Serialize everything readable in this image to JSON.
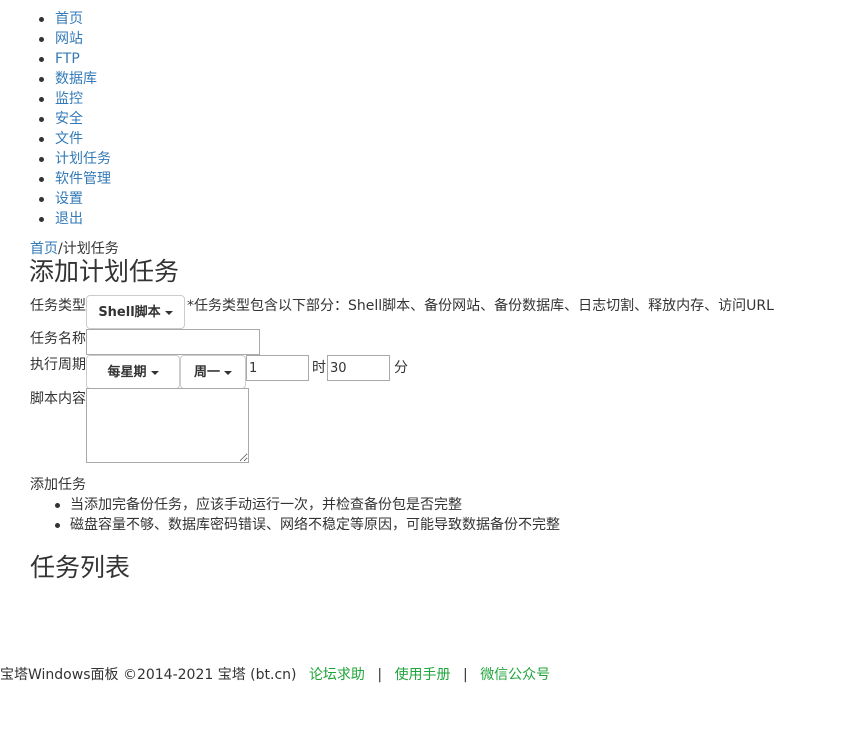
{
  "nav": {
    "items": [
      {
        "label": "首页"
      },
      {
        "label": "网站"
      },
      {
        "label": "FTP"
      },
      {
        "label": "数据库"
      },
      {
        "label": "监控"
      },
      {
        "label": "安全"
      },
      {
        "label": "文件"
      },
      {
        "label": "计划任务"
      },
      {
        "label": "软件管理"
      },
      {
        "label": "设置"
      },
      {
        "label": "退出"
      }
    ]
  },
  "breadcrumb": {
    "home": "首页",
    "separator": "/",
    "current": "计划任务"
  },
  "page_title": "添加计划任务",
  "form": {
    "task_type": {
      "label": "任务类型",
      "selected": "Shell脚本",
      "hint": "*任务类型包含以下部分：Shell脚本、备份网站、备份数据库、日志切割、释放内存、访问URL"
    },
    "task_name": {
      "label": "任务名称",
      "value": ""
    },
    "period": {
      "label": "执行周期",
      "cycle_selected": "每星期",
      "weekday_selected": "周一",
      "hour_value": "1",
      "hour_unit": "时",
      "minute_value": "30",
      "minute_unit": "分"
    },
    "script": {
      "label": "脚本内容",
      "value": ""
    },
    "submit_label": "添加任务"
  },
  "notes": [
    "当添加完备份任务，应该手动运行一次，并检查备份包是否完整",
    "磁盘容量不够、数据库密码错误、网络不稳定等原因，可能导致数据备份不完整"
  ],
  "task_list_title": "任务列表",
  "footer": {
    "copyright": "宝塔Windows面板 ©2014-2021 宝塔 (bt.cn)",
    "link_forum": "论坛求助",
    "link_manual": "使用手册",
    "link_wechat": "微信公众号",
    "separator": "|",
    "link_color": "#20a53a"
  },
  "colors": {
    "link": "#337ab7",
    "text": "#333333"
  }
}
